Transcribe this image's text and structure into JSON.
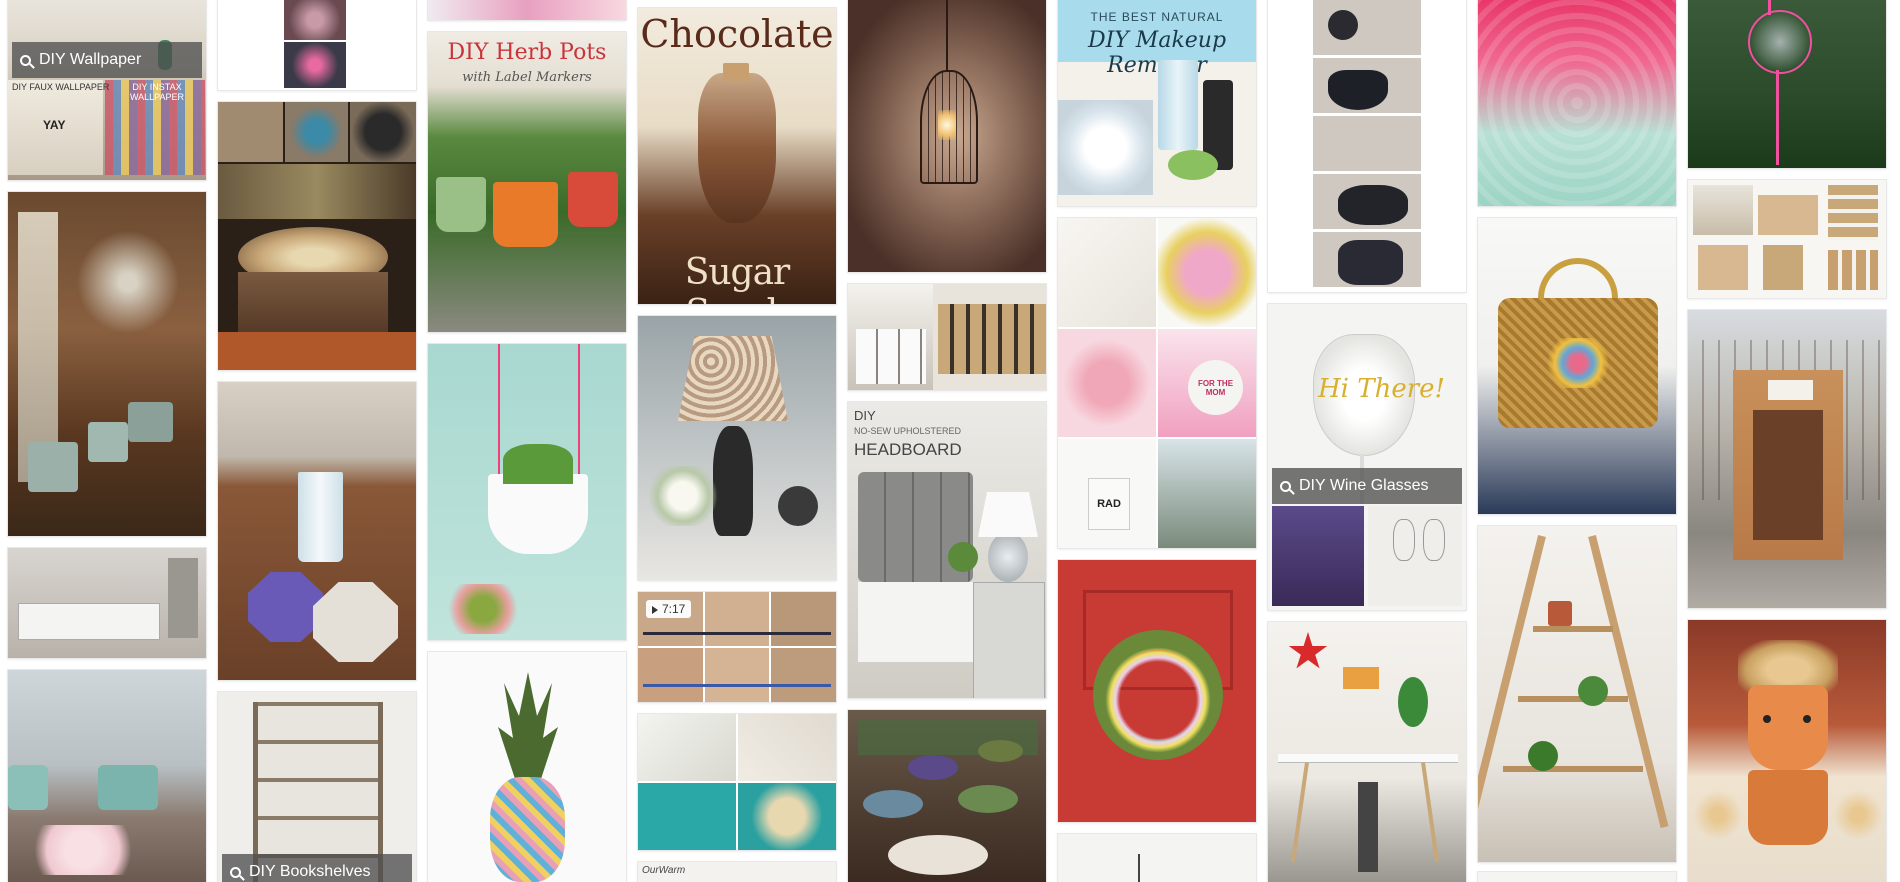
{
  "labels": {
    "wallpaper": "DIY Wallpaper",
    "wine_glasses": "DIY Wine Glasses",
    "bookshelves": "DIY Bookshelves"
  },
  "texts": {
    "faux_wallpaper": "DIY FAUX WALLPAPER",
    "instax_wallpaper": "DIY INSTAX WALLPAPER",
    "yay": "YAY",
    "herb_pots_title": "DIY Herb Pots",
    "herb_pots_sub": "with Label Markers",
    "chocolate": "Chocolate",
    "sugar_scrub": "Sugar Scrub",
    "makeup_top": "THE BEST NATURAL",
    "makeup_title": "DIY Makeup Remover",
    "headboard_diy": "DIY",
    "headboard_sub": "NO-SEW UPHOLSTERED",
    "headboard_title": "HEADBOARD",
    "video_time": "7:17",
    "wine_glass_text": "Hi There!",
    "rad": "RAD",
    "mom": "FOR THE MOM",
    "urwarm": "OurWarm"
  }
}
